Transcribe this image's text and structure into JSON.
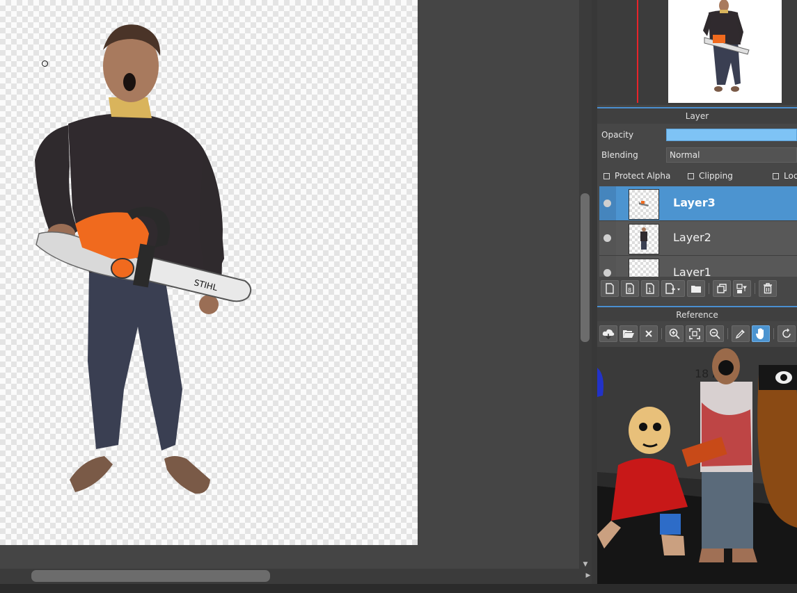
{
  "layer_panel": {
    "title": "Layer",
    "opacity_label": "Opacity",
    "blending_label": "Blending",
    "blending_value": "Normal",
    "checkboxes": [
      "Protect Alpha",
      "Clipping",
      "Loc"
    ],
    "layers": [
      {
        "name": "Layer3",
        "visible": true,
        "selected": true
      },
      {
        "name": "Layer2",
        "visible": true,
        "selected": false
      },
      {
        "name": "Layer1",
        "visible": true,
        "selected": false
      }
    ],
    "toolbar_icons": [
      "new-layer-icon",
      "new-8bit-layer-icon",
      "new-1bit-layer-icon",
      "add-layer-menu-icon",
      "new-folder-icon",
      "duplicate-layer-icon",
      "merge-down-icon",
      "delete-layer-icon"
    ]
  },
  "reference_panel": {
    "title": "Reference",
    "toolbar_icons": [
      "load-icon",
      "open-folder-icon",
      "close-icon",
      "zoom-in-icon",
      "fit-icon",
      "zoom-out-icon",
      "eyedropper-icon",
      "hand-icon",
      "rotate-icon"
    ],
    "active_tool": "hand-icon",
    "image_text": "18 A"
  },
  "colors": {
    "accent": "#4c94d0",
    "opacity_fill": "#7ec3f5",
    "nav_marker": "#e8232a"
  }
}
